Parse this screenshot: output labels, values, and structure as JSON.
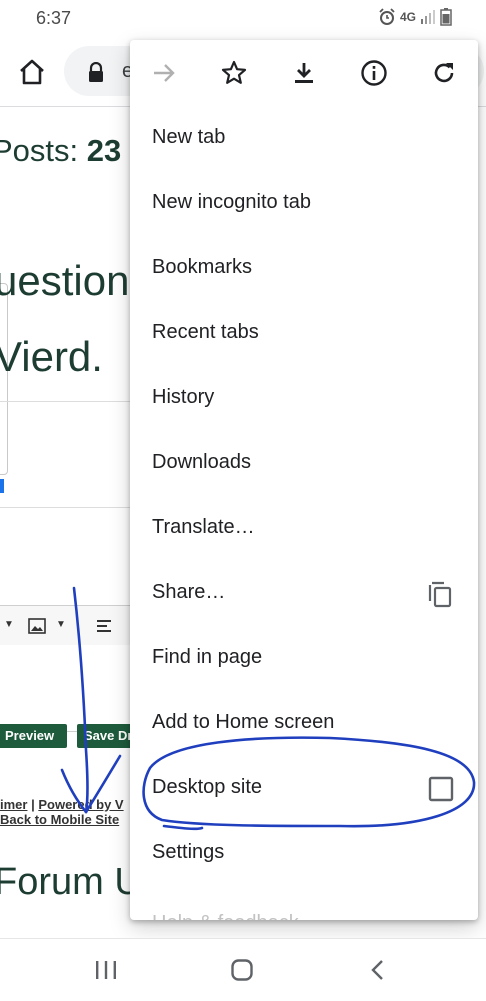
{
  "status_bar": {
    "time": "6:37",
    "network": "4G"
  },
  "toolbar": {
    "url_partial": "e"
  },
  "page": {
    "posts_label": "Posts: ",
    "posts_count": "23",
    "line_question": "uestion",
    "line_wierd": "Vierd.",
    "btn_preview": "Preview",
    "btn_save": "Save Dr",
    "footer_disclaimer": "imer",
    "footer_sep": " | ",
    "footer_powered": "Powered by V",
    "footer_back": "Back to Mobile Site",
    "forum_text": "Forum U"
  },
  "menu": {
    "top_icons": [
      "forward-icon",
      "star-icon",
      "download-icon",
      "info-icon",
      "refresh-icon"
    ],
    "items": [
      {
        "label": "New tab"
      },
      {
        "label": "New incognito tab"
      },
      {
        "label": "Bookmarks"
      },
      {
        "label": "Recent tabs"
      },
      {
        "label": "History"
      },
      {
        "label": "Downloads"
      },
      {
        "label": "Translate…"
      },
      {
        "label": "Share…",
        "trailing_icon": "copy-icon"
      },
      {
        "label": "Find in page"
      },
      {
        "label": "Add to Home screen"
      },
      {
        "label": "Desktop site",
        "trailing_icon": "checkbox",
        "checked": false
      },
      {
        "label": "Settings"
      },
      {
        "label": "Help & feedback"
      }
    ]
  },
  "colors": {
    "annotation": "#1f3fbf",
    "page_green": "#1e3d32",
    "button_green": "#1e5b3c"
  }
}
